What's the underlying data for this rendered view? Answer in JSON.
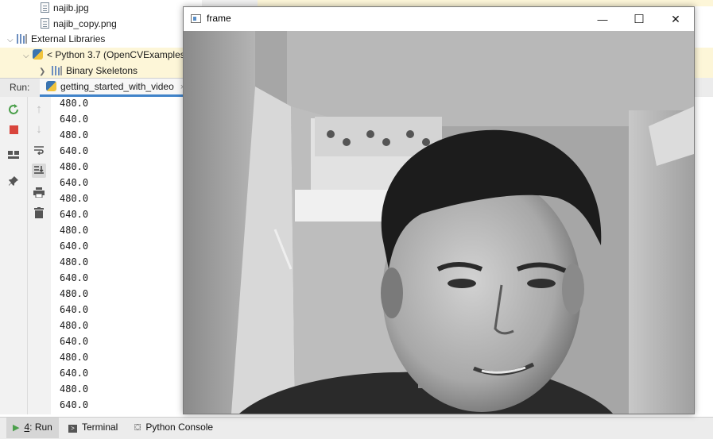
{
  "project_tree": {
    "items": [
      {
        "label": "najib.jpg",
        "icon": "image-file-icon"
      },
      {
        "label": "najib_copy.png",
        "icon": "image-file-icon"
      },
      {
        "label": "External Libraries",
        "icon": "library-icon"
      },
      {
        "label": "< Python 3.7 (OpenCVExamples",
        "icon": "python-icon"
      },
      {
        "label": "Binary Skeletons",
        "icon": "library-icon"
      }
    ]
  },
  "run_panel": {
    "label": "Run:",
    "tab_label": "getting_started_with_video",
    "tab_close": "×"
  },
  "console": {
    "lines": [
      "480.0",
      "640.0",
      "480.0",
      "640.0",
      "480.0",
      "640.0",
      "480.0",
      "640.0",
      "480.0",
      "640.0",
      "480.0",
      "640.0",
      "480.0",
      "640.0",
      "480.0",
      "640.0",
      "480.0",
      "640.0",
      "480.0",
      "640.0"
    ]
  },
  "bottom_bar": {
    "run_tab_number": "4",
    "run_tab_label": ": Run",
    "terminal_label": "Terminal",
    "python_console_label": "Python Console"
  },
  "frame_window": {
    "title": "frame",
    "minimize_glyph": "—",
    "maximize_glyph": "☐",
    "close_glyph": "✕"
  },
  "colors": {
    "stop_red": "#d9453c",
    "rerun_green": "#4b9f4b",
    "tab_underline": "#4083c9",
    "selection_band": "#fdf6d8"
  }
}
